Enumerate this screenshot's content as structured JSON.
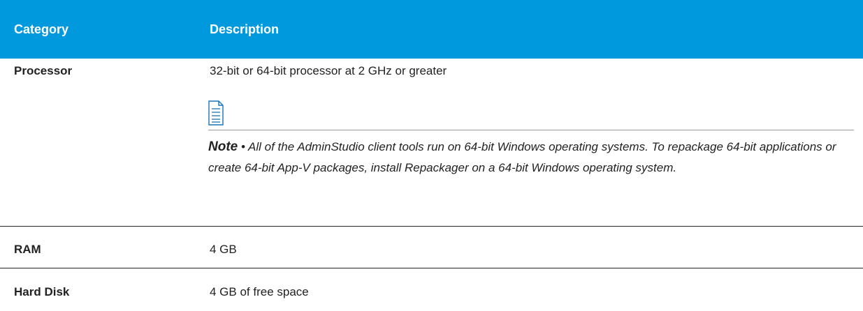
{
  "header": {
    "category": "Category",
    "description": "Description"
  },
  "rows": [
    {
      "category": "Processor",
      "description": "32-bit or 64-bit processor at 2 GHz or greater",
      "note": {
        "icon": "note-document-icon",
        "label": "Note",
        "separator": "•",
        "text": "All of the AdminStudio client tools run on 64-bit Windows operating systems. To repackage 64-bit applications or create 64-bit App-V packages, install Repackager on a 64-bit Windows operating system."
      }
    },
    {
      "category": "RAM",
      "description": "4 GB"
    },
    {
      "category": "Hard Disk",
      "description": "4 GB of free space"
    }
  ],
  "colors": {
    "header_bg": "#0099de",
    "header_text": "#ffffff",
    "body_text": "#222222",
    "icon": "#1a73b8"
  }
}
